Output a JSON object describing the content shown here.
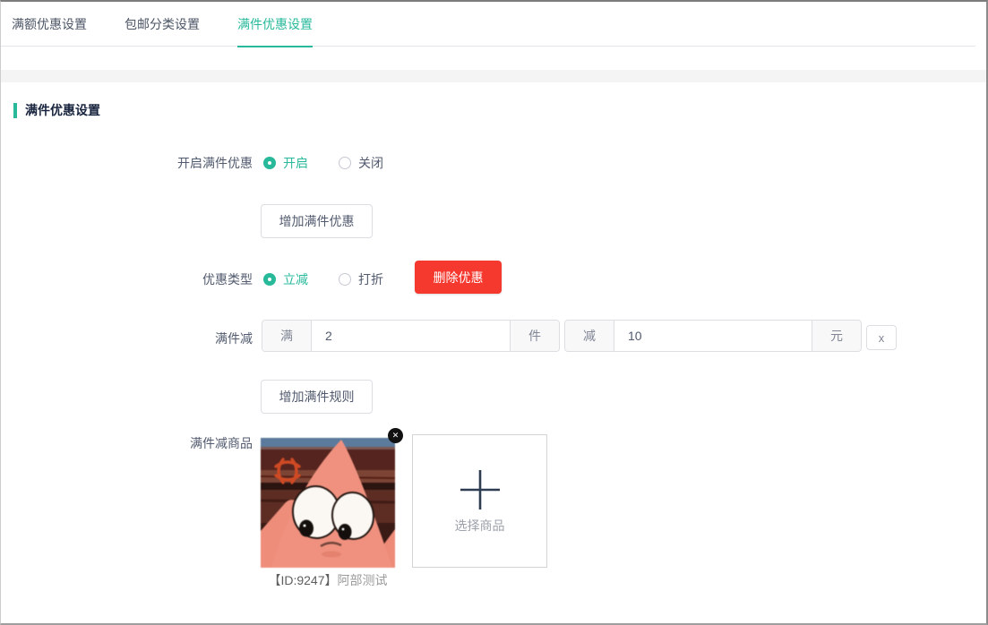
{
  "tabs": {
    "items": [
      {
        "label": "满额优惠设置"
      },
      {
        "label": "包邮分类设置"
      },
      {
        "label": "满件优惠设置"
      }
    ],
    "active_index": 2
  },
  "section_title": "满件优惠设置",
  "form": {
    "enable_row": {
      "label": "开启满件优惠",
      "option_on": "开启",
      "option_off": "关闭",
      "selected": "开启"
    },
    "add_discount_button": "增加满件优惠",
    "type_row": {
      "label": "优惠类型",
      "option_minus": "立减",
      "option_discount": "打折",
      "selected": "立减",
      "delete_button": "删除优惠"
    },
    "rule_row": {
      "label": "满件减",
      "group1": {
        "prefix": "满",
        "value": "2",
        "suffix": "件"
      },
      "group2": {
        "prefix": "减",
        "value": "10",
        "suffix": "元"
      },
      "remove_button": "x"
    },
    "add_rule_button": "增加满件规则",
    "product_row": {
      "label": "满件减商品",
      "product_caption_id": "【ID:9247】",
      "product_caption_name": "阿部测试",
      "remove_icon": "✕",
      "select_label": "选择商品"
    }
  },
  "colors": {
    "accent": "#28b99b",
    "danger": "#f5392f"
  }
}
